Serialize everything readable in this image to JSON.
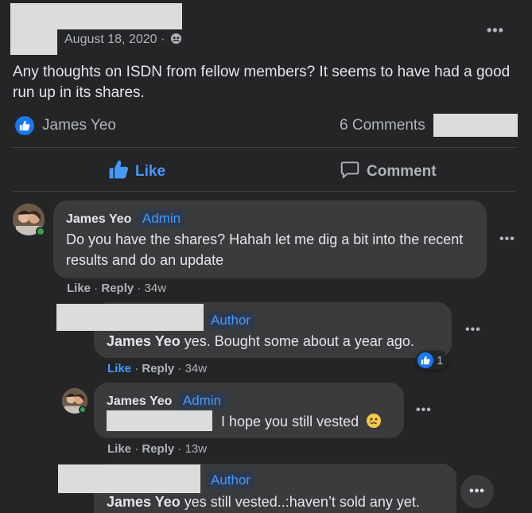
{
  "post": {
    "date": "August 18, 2020 ·",
    "text": "Any thoughts on ISDN from fellow members?  It seems to have had a good run up in its shares.",
    "reactor": "James Yeo",
    "comments_count": "6 Comments",
    "more": "•••"
  },
  "actions": {
    "like_label": "Like",
    "comment_label": "Comment"
  },
  "comments": [
    {
      "name": "James Yeo",
      "badge": "Admin",
      "text": "Do you have the shares? Hahah let me dig a bit into the recent results and do an update",
      "like": "Like",
      "reply": "Reply",
      "time": "34w"
    },
    {
      "badge": "Author",
      "mention": "James Yeo",
      "text": " yes. Bought some about a year ago.",
      "like": "Like",
      "reply": "Reply",
      "time": "34w",
      "reaction_count": "1"
    },
    {
      "name": "James Yeo",
      "badge": "Admin",
      "text": "I hope you still vested",
      "like": "Like",
      "reply": "Reply",
      "time": "13w"
    },
    {
      "badge": "Author",
      "mention": "James Yeo",
      "text": " yes still vested..:haven’t sold any yet."
    }
  ],
  "ui": {
    "more_dots": "•••",
    "dot_sep": "·",
    "accent": "#4599ff",
    "online": "#31a24c"
  }
}
